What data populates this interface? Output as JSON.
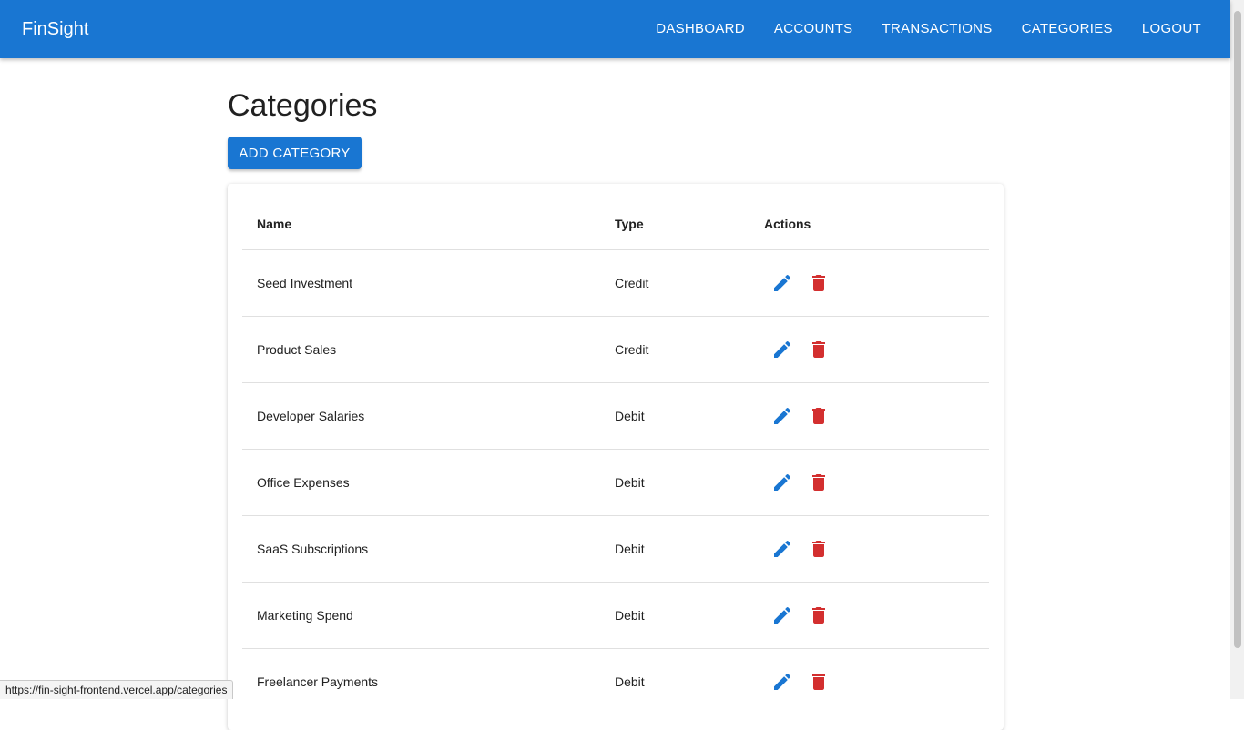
{
  "header": {
    "brand": "FinSight",
    "nav": [
      "DASHBOARD",
      "ACCOUNTS",
      "TRANSACTIONS",
      "CATEGORIES",
      "LOGOUT"
    ]
  },
  "main": {
    "title": "Categories",
    "add_button": "ADD CATEGORY"
  },
  "table": {
    "headers": {
      "name": "Name",
      "type": "Type",
      "actions": "Actions"
    },
    "rows": [
      {
        "name": "Seed Investment",
        "type": "Credit"
      },
      {
        "name": "Product Sales",
        "type": "Credit"
      },
      {
        "name": "Developer Salaries",
        "type": "Debit"
      },
      {
        "name": "Office Expenses",
        "type": "Debit"
      },
      {
        "name": "SaaS Subscriptions",
        "type": "Debit"
      },
      {
        "name": "Marketing Spend",
        "type": "Debit"
      },
      {
        "name": "Freelancer Payments",
        "type": "Debit"
      }
    ],
    "action_icons": {
      "edit": "pencil-icon",
      "delete": "trash-icon"
    }
  },
  "status_bar": {
    "url": "https://fin-sight-frontend.vercel.app/categories"
  },
  "colors": {
    "primary": "#1976d2",
    "delete": "#d32f2f",
    "text": "#212121",
    "divider": "#e0e0e0"
  }
}
